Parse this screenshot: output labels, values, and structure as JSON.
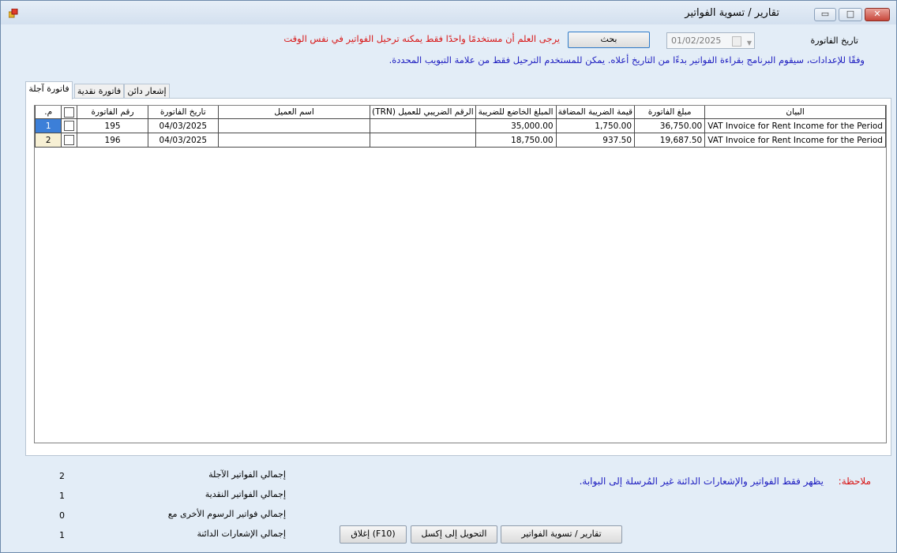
{
  "window": {
    "title": "تقارير / تسوية الفواتير",
    "app_icon": "app-form-icon",
    "min_glyph": "▭",
    "max_glyph": "□",
    "close_glyph": "✕"
  },
  "filter": {
    "date_label": "تاريخ الفاتورة",
    "date_value": "01/02/2025",
    "search_button": "بحث",
    "warning_text": "يرجى العلم أن مستخدمًا واحدًا فقط يمكنه ترحيل الفواتير في نفس الوقت",
    "info_text": "وفقًا للإعدادات، سيقوم البرنامج بقراءة الفواتير بدءًا من التاريخ أعلاه. يمكن للمستخدم الترحيل فقط من علامة التبويب المحددة."
  },
  "tabs": [
    {
      "label": "فاتورة آجلة",
      "active": true
    },
    {
      "label": "فاتورة نقدية",
      "active": false
    },
    {
      "label": "إشعار دائن",
      "active": false
    }
  ],
  "grid": {
    "headers": {
      "row_no": ".م",
      "invoice_no": "رقم الفاتورة",
      "invoice_date": "تاريخ الفاتورة",
      "customer_name": "اسم العميل",
      "trn": "الرقم الضريبي للعميل (TRN)",
      "taxable_amount": "المبلغ الخاضع للضريبة",
      "vat_amount": "قيمة الضريبة المضافة",
      "invoice_amount": "مبلغ الفاتورة",
      "description": "البيان"
    },
    "rows": [
      {
        "row_no": "1",
        "invoice_no": "195",
        "invoice_date": "04/03/2025",
        "customer_name": "",
        "trn": "",
        "taxable_amount": "35,000.00",
        "vat_amount": "1,750.00",
        "invoice_amount": "36,750.00",
        "description": "VAT Invoice for Rent Income for the Period"
      },
      {
        "row_no": "2",
        "invoice_no": "196",
        "invoice_date": "04/03/2025",
        "customer_name": "",
        "trn": "",
        "taxable_amount": "18,750.00",
        "vat_amount": "937.50",
        "invoice_amount": "19,687.50",
        "description": "VAT Invoice for Rent Income for the Period"
      }
    ]
  },
  "totals": {
    "deferred_label": "إجمالي الفواتير الآجلة",
    "deferred_value": "2",
    "cash_label": "إجمالي الفواتير النقدية",
    "cash_value": "1",
    "other_fees_label": "إجمالي فواتير الرسوم الأخرى مع",
    "other_fees_value": "0",
    "credit_notes_label": "إجمالي الإشعارات الدائنة",
    "credit_notes_value": "1"
  },
  "note": {
    "label": "ملاحظة:",
    "text": "يظهر فقط الفواتير والإشعارات الدائنة غير المُرسلة إلى البوابة."
  },
  "buttons": {
    "close": "إغلاق (F10)",
    "export_excel": "التحويل إلى إكسل",
    "reports": "تقارير / تسوية الفواتير"
  },
  "colors": {
    "warning": "#d81515",
    "info": "#1d1dc0",
    "selected_row": "#3c7fd8"
  }
}
